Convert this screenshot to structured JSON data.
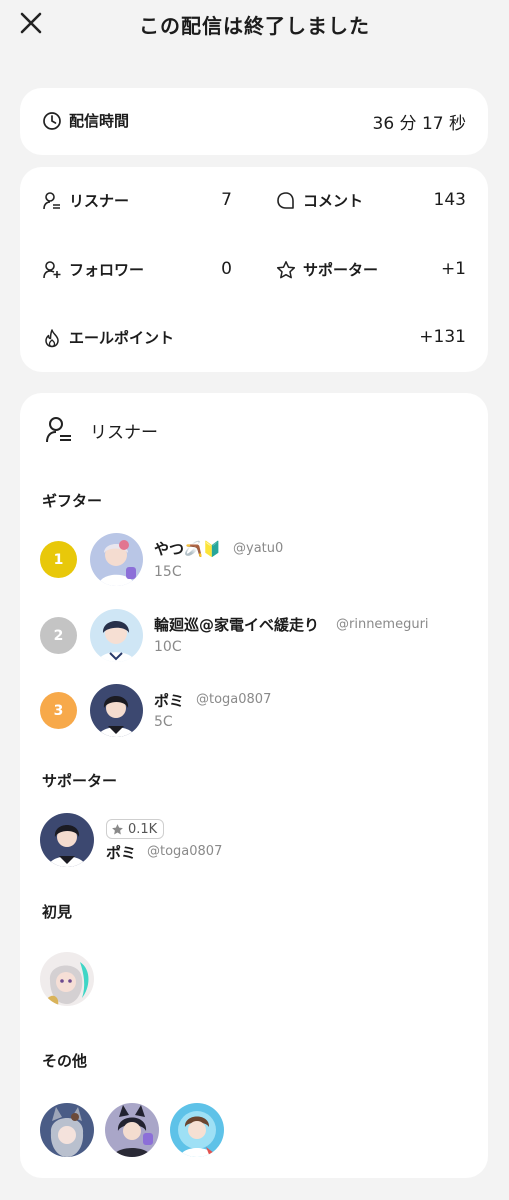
{
  "header": {
    "title": "この配信は終了しました",
    "close_icon": "close-icon"
  },
  "duration": {
    "label": "配信時間",
    "value": "36 分 17 秒",
    "icon": "clock-icon"
  },
  "stats": {
    "listeners": {
      "label": "リスナー",
      "value": "7",
      "icon": "person-list-icon"
    },
    "comments": {
      "label": "コメント",
      "value": "143",
      "icon": "chat-bubble-icon"
    },
    "followers": {
      "label": "フォロワー",
      "value": "0",
      "icon": "person-add-icon"
    },
    "supporters": {
      "label": "サポーター",
      "value": "+1",
      "icon": "star-outline-icon"
    },
    "yell_points": {
      "label": "エールポイント",
      "value": "+131",
      "icon": "flame-icon"
    }
  },
  "listeners_section": {
    "title": "リスナー",
    "icon": "listener-icon",
    "gifters_title": "ギフター",
    "gifters": [
      {
        "rank": "1",
        "name": "やつ🪃🔰",
        "handle": "@yatu0",
        "coins": "15C",
        "rank_color": "#e8c80a"
      },
      {
        "rank": "2",
        "name": "輪廻巡@家電イベ緩走り",
        "handle": "@rinnemeguri",
        "coins": "10C",
        "rank_color": "#c4c4c4"
      },
      {
        "rank": "3",
        "name": "ポミ",
        "handle": "@toga0807",
        "coins": "5C",
        "rank_color": "#f7a94a"
      }
    ],
    "supporters_title": "サポーター",
    "supporter": {
      "badge": "0.1K",
      "name": "ポミ",
      "handle": "@toga0807"
    },
    "first_time_title": "初見",
    "others_title": "その他"
  }
}
